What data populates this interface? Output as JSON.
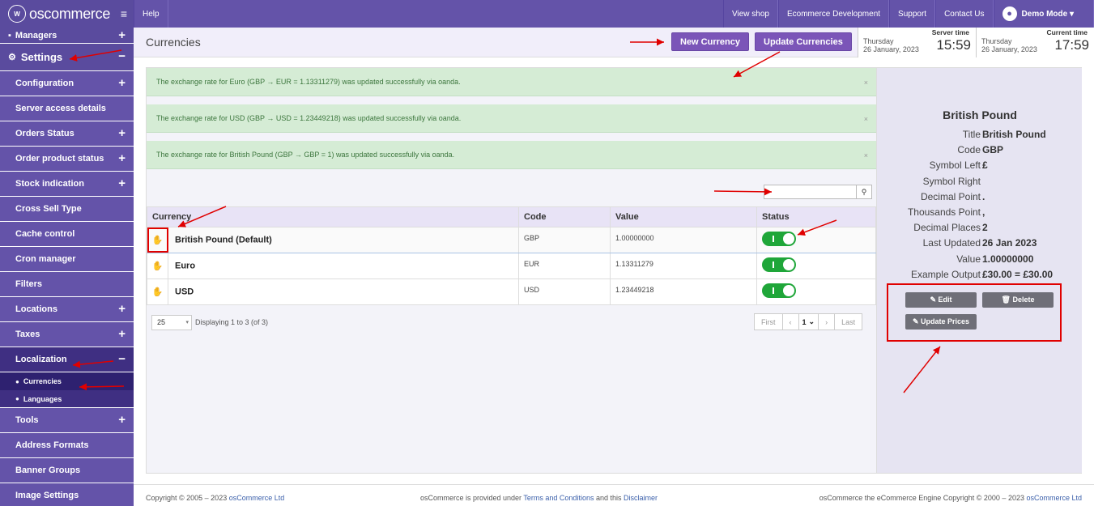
{
  "brand": {
    "name": "oscommerce",
    "mark": "W"
  },
  "topbar": {
    "help": "Help",
    "view_shop": "View shop",
    "ecommerce_dev": "Ecommerce Development",
    "support": "Support",
    "contact": "Contact Us",
    "user": "Demo Mode ▾"
  },
  "sidebar": {
    "managers": "Managers",
    "settings": "Settings",
    "items": [
      "Configuration",
      "Server access details",
      "Orders Status",
      "Order product status",
      "Stock indication",
      "Cross Sell Type",
      "Cache control",
      "Cron manager",
      "Filters",
      "Locations",
      "Taxes"
    ],
    "localization": "Localization",
    "sub": [
      "Currencies",
      "Languages"
    ],
    "after": [
      "Tools",
      "Address Formats",
      "Banner Groups",
      "Image Settings"
    ]
  },
  "page": {
    "title": "Currencies",
    "new_currency": "New Currency",
    "update_currencies": "Update Currencies"
  },
  "server_time": {
    "label": "Server time",
    "day": "Thursday",
    "date": "26 January, 2023",
    "time": "15:59"
  },
  "current_time": {
    "label": "Current time",
    "day": "Thursday",
    "date": "26 January, 2023",
    "time": "17:59"
  },
  "alerts": [
    "The exchange rate for Euro (GBP → EUR = 1.13311279) was updated successfully via oanda.",
    "The exchange rate for USD (GBP → USD = 1.23449218) was updated successfully via oanda.",
    "The exchange rate for British Pound (GBP → GBP = 1) was updated successfully via oanda."
  ],
  "alert_close": "×",
  "table": {
    "headers": [
      "Currency",
      "Code",
      "Value",
      "Status"
    ],
    "rows": [
      {
        "currency": "British Pound (Default)",
        "code": "GBP",
        "value": "1.00000000"
      },
      {
        "currency": "Euro",
        "code": "EUR",
        "value": "1.13311279"
      },
      {
        "currency": "USD",
        "code": "USD",
        "value": "1.23449218"
      }
    ]
  },
  "pagination": {
    "per_page": "25",
    "display": "Displaying 1 to 3 (of 3)",
    "first": "First",
    "prev": "‹",
    "page": "1",
    "next": "›",
    "last": "Last"
  },
  "panel": {
    "title": "British Pound",
    "fields": [
      {
        "k": "Title",
        "v": "British Pound"
      },
      {
        "k": "Code",
        "v": "GBP"
      },
      {
        "k": "Symbol Left",
        "v": "£"
      },
      {
        "k": "Symbol Right",
        "v": ""
      },
      {
        "k": "Decimal Point",
        "v": "."
      },
      {
        "k": "Thousands Point",
        "v": ","
      },
      {
        "k": "Decimal Places",
        "v": "2"
      },
      {
        "k": "Last Updated",
        "v": "26 Jan 2023"
      },
      {
        "k": "Value",
        "v": "1.00000000"
      },
      {
        "k": "Example Output",
        "v": "£30.00 = £30.00"
      }
    ],
    "edit": "✎ Edit",
    "delete": "🗑 Delete",
    "update_prices": "✎ Update Prices"
  },
  "footer": {
    "copy": "Copyright © 2005 – 2023 ",
    "copy_link": "osCommerce Ltd",
    "mid1": "osCommerce is provided under ",
    "terms": "Terms and Conditions",
    "mid2": " and this ",
    "disclaimer": "Disclaimer",
    "right": "osCommerce the eCommerce Engine Copyright © 2000 – 2023 ",
    "right_link": "osCommerce Ltd"
  },
  "colors": {
    "accent": "#6453a9",
    "button": "#7b55b8",
    "success": "#d5ecd5",
    "toggle_on": "#1fa639",
    "annotation": "#e00000"
  }
}
